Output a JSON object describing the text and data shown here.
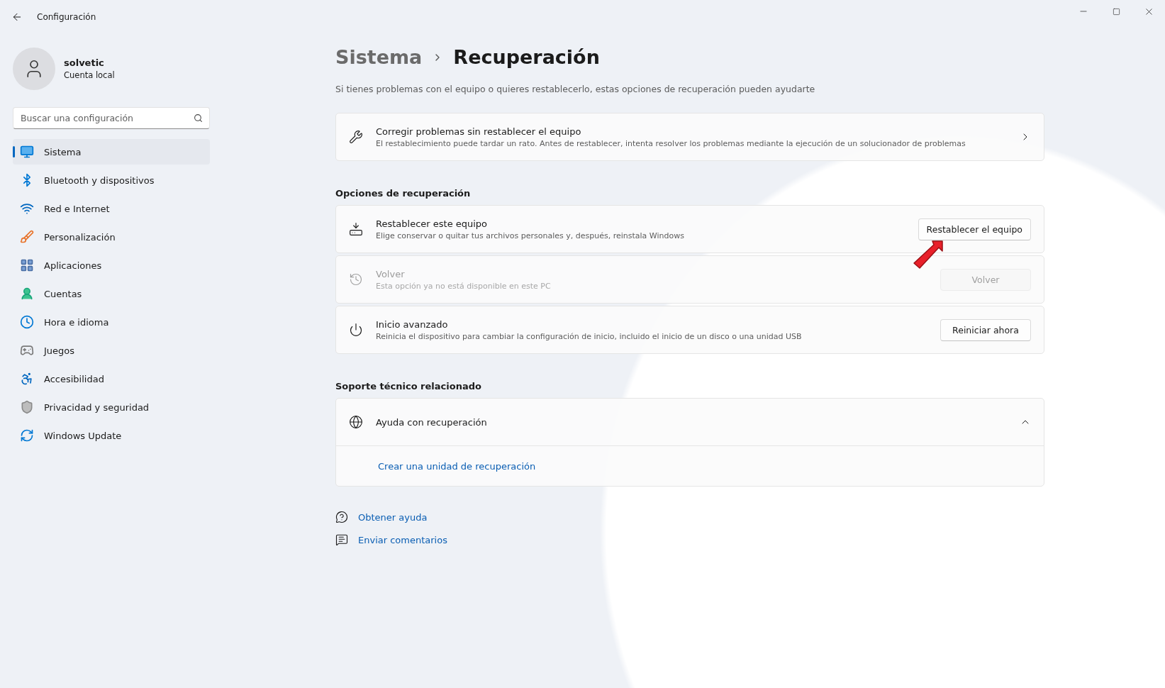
{
  "window": {
    "title": "Configuración"
  },
  "user": {
    "name": "solvetic",
    "account": "Cuenta local"
  },
  "search": {
    "placeholder": "Buscar una configuración"
  },
  "sidebar": {
    "items": [
      {
        "label": "Sistema",
        "selected": true,
        "kind": "system"
      },
      {
        "label": "Bluetooth y dispositivos",
        "selected": false,
        "kind": "bluetooth"
      },
      {
        "label": "Red e Internet",
        "selected": false,
        "kind": "network"
      },
      {
        "label": "Personalización",
        "selected": false,
        "kind": "personalize"
      },
      {
        "label": "Aplicaciones",
        "selected": false,
        "kind": "apps"
      },
      {
        "label": "Cuentas",
        "selected": false,
        "kind": "accounts"
      },
      {
        "label": "Hora e idioma",
        "selected": false,
        "kind": "time"
      },
      {
        "label": "Juegos",
        "selected": false,
        "kind": "games"
      },
      {
        "label": "Accesibilidad",
        "selected": false,
        "kind": "accessibility"
      },
      {
        "label": "Privacidad y seguridad",
        "selected": false,
        "kind": "privacy"
      },
      {
        "label": "Windows Update",
        "selected": false,
        "kind": "update"
      }
    ]
  },
  "breadcrumb": {
    "parent": "Sistema",
    "current": "Recuperación"
  },
  "description": "Si tienes problemas con el equipo o quieres restablecerlo, estas opciones de recuperación pueden ayudarte",
  "top_card": {
    "title": "Corregir problemas sin restablecer el equipo",
    "subtitle": "El restablecimiento puede tardar un rato. Antes de restablecer, intenta resolver los problemas mediante la ejecución de un solucionador de problemas"
  },
  "recovery": {
    "heading": "Opciones de recuperación",
    "items": [
      {
        "kind": "reset",
        "title": "Restablecer este equipo",
        "subtitle": "Elige conservar o quitar tus archivos personales y, después, reinstala Windows",
        "button": "Restablecer el equipo",
        "disabled": false
      },
      {
        "kind": "history",
        "title": "Volver",
        "subtitle": "Esta opción ya no está disponible en este PC",
        "button": "Volver",
        "disabled": true
      },
      {
        "kind": "advanced",
        "title": "Inicio avanzado",
        "subtitle": "Reinicia el dispositivo para cambiar la configuración de inicio, incluido el inicio de un disco o una unidad USB",
        "button": "Reiniciar ahora",
        "disabled": false
      }
    ]
  },
  "support": {
    "heading": "Soporte técnico relacionado",
    "title": "Ayuda con recuperación",
    "expanded": true,
    "link": "Crear una unidad de recuperación"
  },
  "footer_links": [
    {
      "kind": "help",
      "label": "Obtener ayuda"
    },
    {
      "kind": "feedback",
      "label": "Enviar comentarios"
    }
  ]
}
